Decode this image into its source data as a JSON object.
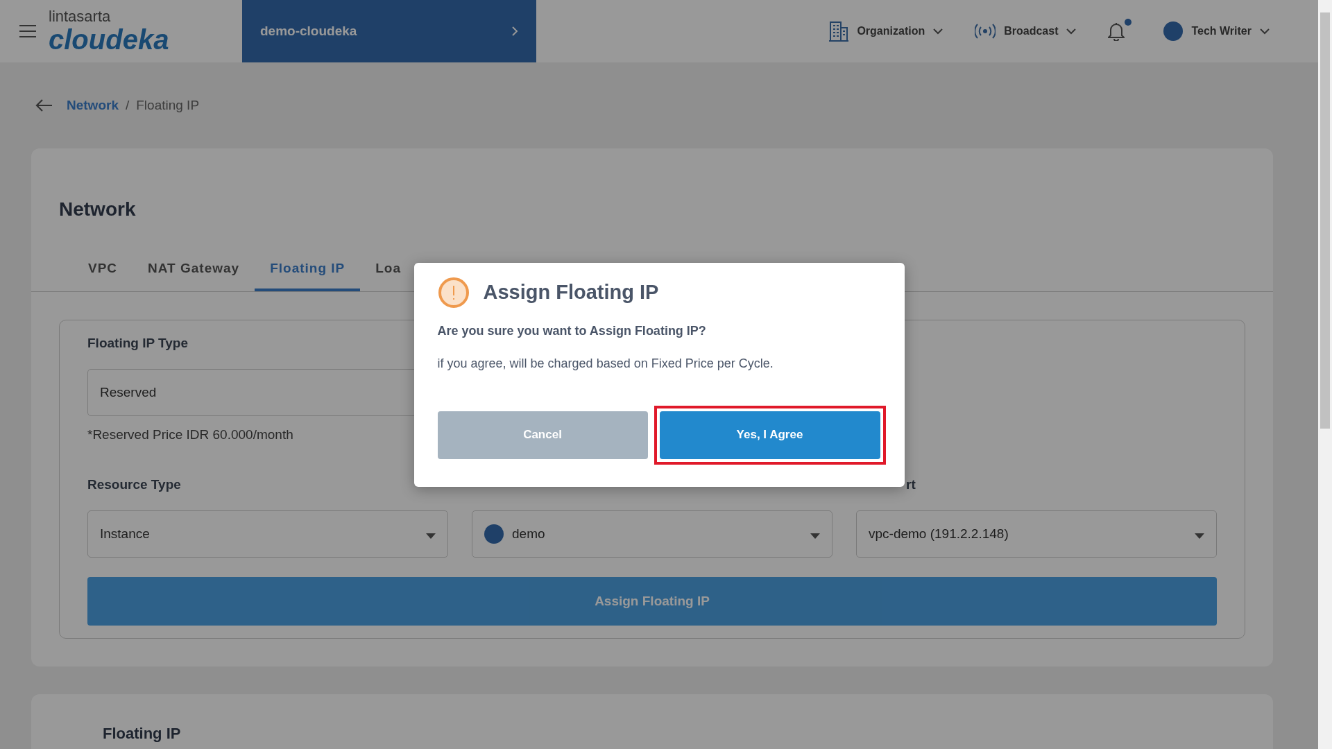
{
  "header": {
    "logo_top": "lintasarta",
    "logo_name": "cloudeka",
    "project": "demo-cloudeka",
    "menus": [
      {
        "kind": "organization",
        "label": "Organization"
      },
      {
        "kind": "broadcast",
        "label": "Broadcast"
      }
    ],
    "notifications": {
      "unread": true
    },
    "user": {
      "name": "Tech Writer"
    }
  },
  "breadcrumb": {
    "parent": "Network",
    "separator": "/",
    "current": "Floating IP"
  },
  "page_title": "Network",
  "tabs": [
    {
      "label": "VPC",
      "selected": false
    },
    {
      "label": "NAT Gateway",
      "selected": false
    },
    {
      "label": "Floating IP",
      "selected": true
    },
    {
      "label": "Loa",
      "selected": false
    }
  ],
  "form": {
    "type_label": "Floating IP Type",
    "type_value": "Reserved",
    "price_note": "*Reserved Price IDR 60.000/month",
    "resources": [
      {
        "label": "Resource Type",
        "value": "Instance",
        "kind": "plain"
      },
      {
        "value": "demo",
        "kind": "avatar"
      },
      {
        "label": "rt",
        "value": "vpc-demo (191.2.2.148)",
        "kind": "plain"
      }
    ],
    "submit": "Assign Floating IP"
  },
  "list_title": "Floating IP",
  "dialog": {
    "title": "Assign Floating IP",
    "question": "Are you sure you want to Assign Floating IP?",
    "message": "if you agree, will be charged based on Fixed Price per Cycle.",
    "buttons": [
      {
        "label": "Cancel",
        "kind": "secondary",
        "highlighted": false
      },
      {
        "label": "Yes, I Agree",
        "kind": "primary",
        "highlighted": true
      }
    ]
  }
}
